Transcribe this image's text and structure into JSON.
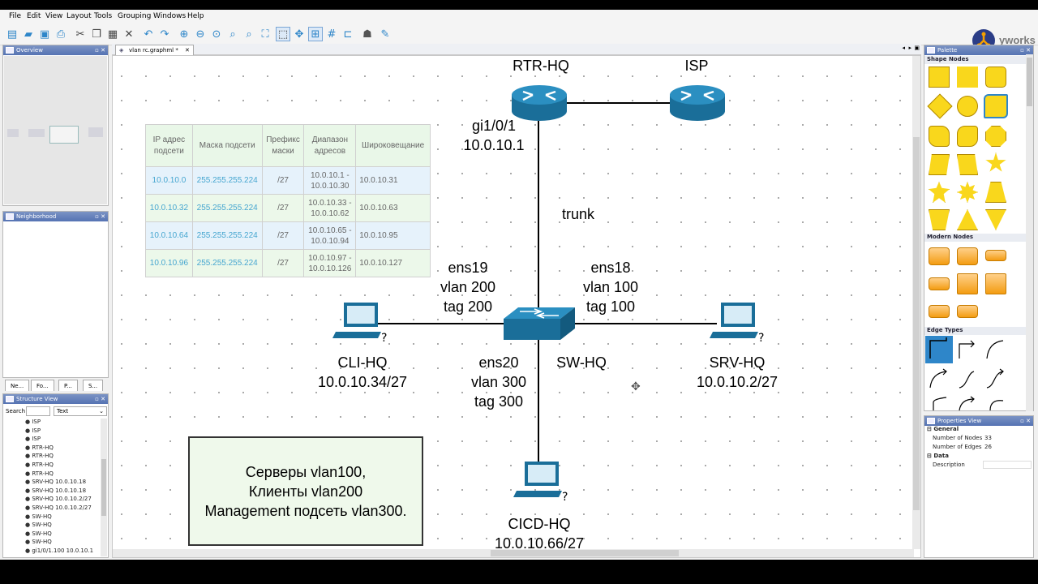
{
  "menu": [
    "File",
    "Edit",
    "View",
    "Layout",
    "Tools",
    "Grouping",
    "Windows",
    "Help"
  ],
  "brand": "yworks",
  "left_panels": {
    "overview": "Overview",
    "neighborhood": "Neighborhood",
    "dock_tabs": [
      "Ne...",
      "Fo...",
      "P...",
      "S..."
    ],
    "structure_view": "Structure View",
    "search_label": "Search",
    "search_mode": "Text",
    "structure_items": [
      "ISP",
      "ISP",
      "ISP",
      "RTR-HQ",
      "RTR-HQ",
      "RTR-HQ",
      "RTR-HQ",
      "SRV-HQ 10.0.10.18",
      "SRV-HQ 10.0.10.18",
      "SRV-HQ 10.0.10.2/27",
      "SRV-HQ 10.0.10.2/27",
      "SW-HQ",
      "SW-HQ",
      "SW-HQ",
      "SW-HQ",
      "gi1/0/1.100 10.0.10.1"
    ]
  },
  "document_tab": "vlan rc.graphml *",
  "diagram": {
    "nodes": {
      "rtr": "RTR-HQ",
      "isp": "ISP",
      "sw": "SW-HQ",
      "cli_name": "CLI-HQ",
      "cli_ip": "10.0.10.34/27",
      "srv_name": "SRV-HQ",
      "srv_ip": "10.0.10.2/27",
      "cicd_name": "CICD-HQ",
      "cicd_ip": "10.0.10.66/27"
    },
    "labels": {
      "gi_port": "gi1/0/1",
      "gi_ip": "10.0.10.1",
      "trunk": "trunk",
      "ens19": "ens19",
      "vlan200": "vlan 200",
      "tag200": "tag 200",
      "ens18": "ens18",
      "vlan100": "vlan 100",
      "tag100": "tag 100",
      "ens20": "ens20",
      "vlan300": "vlan 300",
      "tag300": "tag 300"
    },
    "table": {
      "headers": [
        "IP адрес подсети",
        "Маска подсети",
        "Префикс маски",
        "Диапазон адресов",
        "Широковещание"
      ],
      "rows": [
        [
          "10.0.10.0",
          "255.255.255.224",
          "/27",
          "10.0.10.1 - 10.0.10.30",
          "10.0.10.31"
        ],
        [
          "10.0.10.32",
          "255.255.255.224",
          "/27",
          "10.0.10.33 - 10.0.10.62",
          "10.0.10.63"
        ],
        [
          "10.0.10.64",
          "255.255.255.224",
          "/27",
          "10.0.10.65 - 10.0.10.94",
          "10.0.10.95"
        ],
        [
          "10.0.10.96",
          "255.255.255.224",
          "/27",
          "10.0.10.97 - 10.0.10.126",
          "10.0.10.127"
        ]
      ]
    },
    "note": [
      "Серверы  vlan100,",
      "Клиенты  vlan200",
      "Management подсеть vlan300."
    ]
  },
  "palette": {
    "title": "Palette",
    "sections": [
      "Shape Nodes",
      "Modern Nodes",
      "Edge Types"
    ]
  },
  "properties": {
    "title": "Properties View",
    "general": "General",
    "nodes_label": "Number of Nodes",
    "nodes_value": "33",
    "edges_label": "Number of Edges",
    "edges_value": "26",
    "data": "Data",
    "description": "Description"
  }
}
